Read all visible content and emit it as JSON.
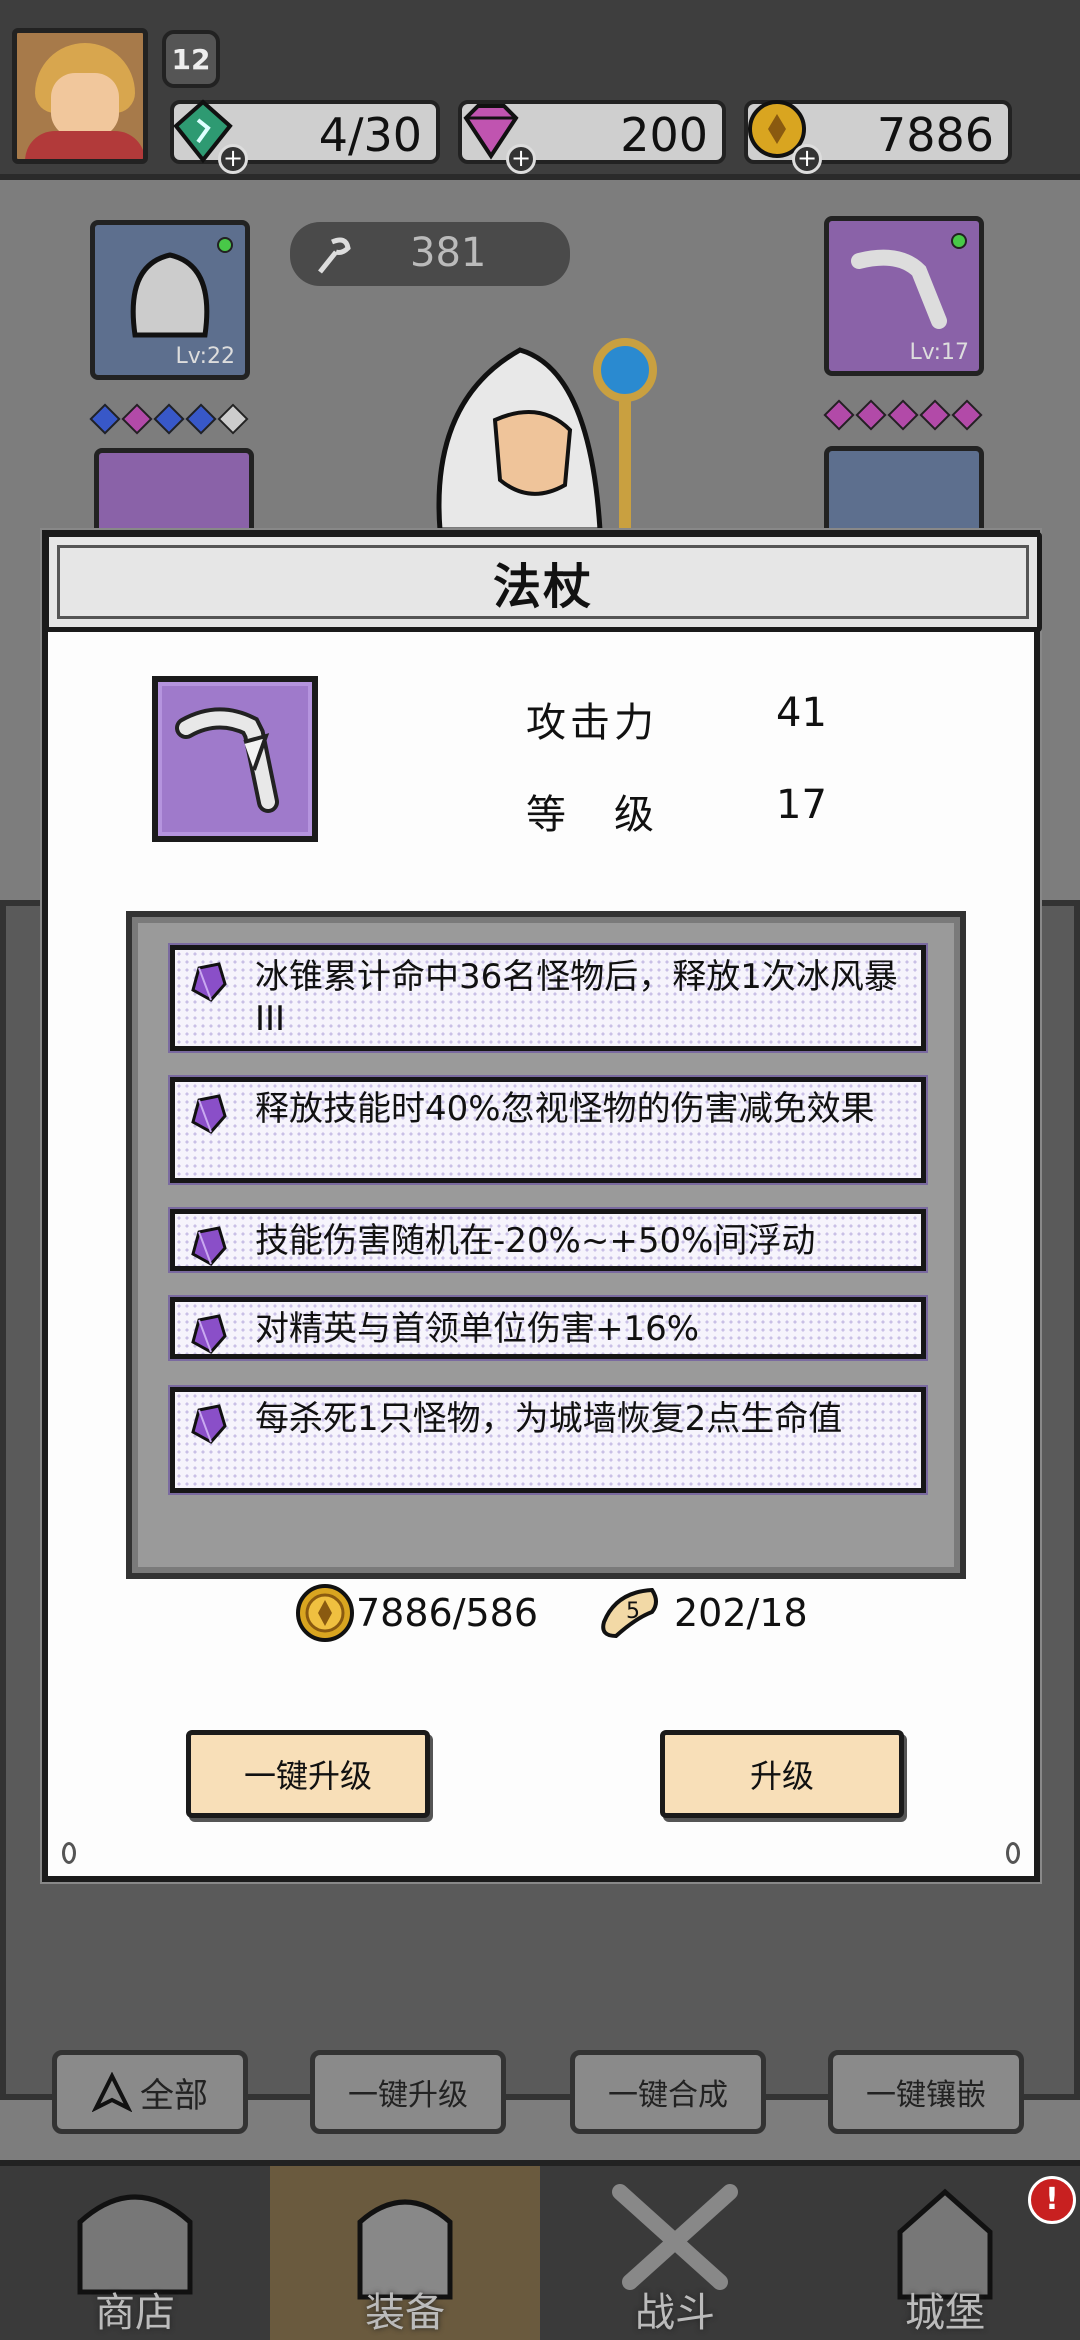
{
  "header": {
    "level": "12",
    "energy": "4/30",
    "gems": "200",
    "coins": "7886"
  },
  "equipment": {
    "power": "381",
    "left_slot_level": "Lv:22",
    "right_slot_level": "Lv:17"
  },
  "modal": {
    "title": "法杖",
    "stats": [
      {
        "key": "攻击力",
        "value": "41"
      },
      {
        "key": "等　级",
        "value": "17"
      }
    ],
    "affixes": [
      {
        "text": "冰锥累计命中36名怪物后，释放1次冰风暴III"
      },
      {
        "text": "释放技能时40%忽视怪物的伤害减免效果"
      },
      {
        "text": "技能伤害随机在-20%~+50%间浮动"
      },
      {
        "text": "对精英与首领单位伤害+16%"
      },
      {
        "text": "每杀死1只怪物，为城墙恢复2点生命值"
      }
    ],
    "cost_coins": "7886/586",
    "cost_scroll": "202/18",
    "one_click_upgrade": "一键升级",
    "upgrade": "升级"
  },
  "actions": {
    "filter_all": "全部",
    "upgrade_all": "一键升级",
    "merge_all": "一键合成",
    "inlay_all": "一键镶嵌"
  },
  "nav": {
    "shop": "商店",
    "equip": "装备",
    "battle": "战斗",
    "castle": "城堡",
    "castle_alert": "!"
  },
  "colors": {
    "item_purple": "#9f7acb",
    "button_cream": "#f8dfb8",
    "coin_gold": "#d9a520"
  }
}
